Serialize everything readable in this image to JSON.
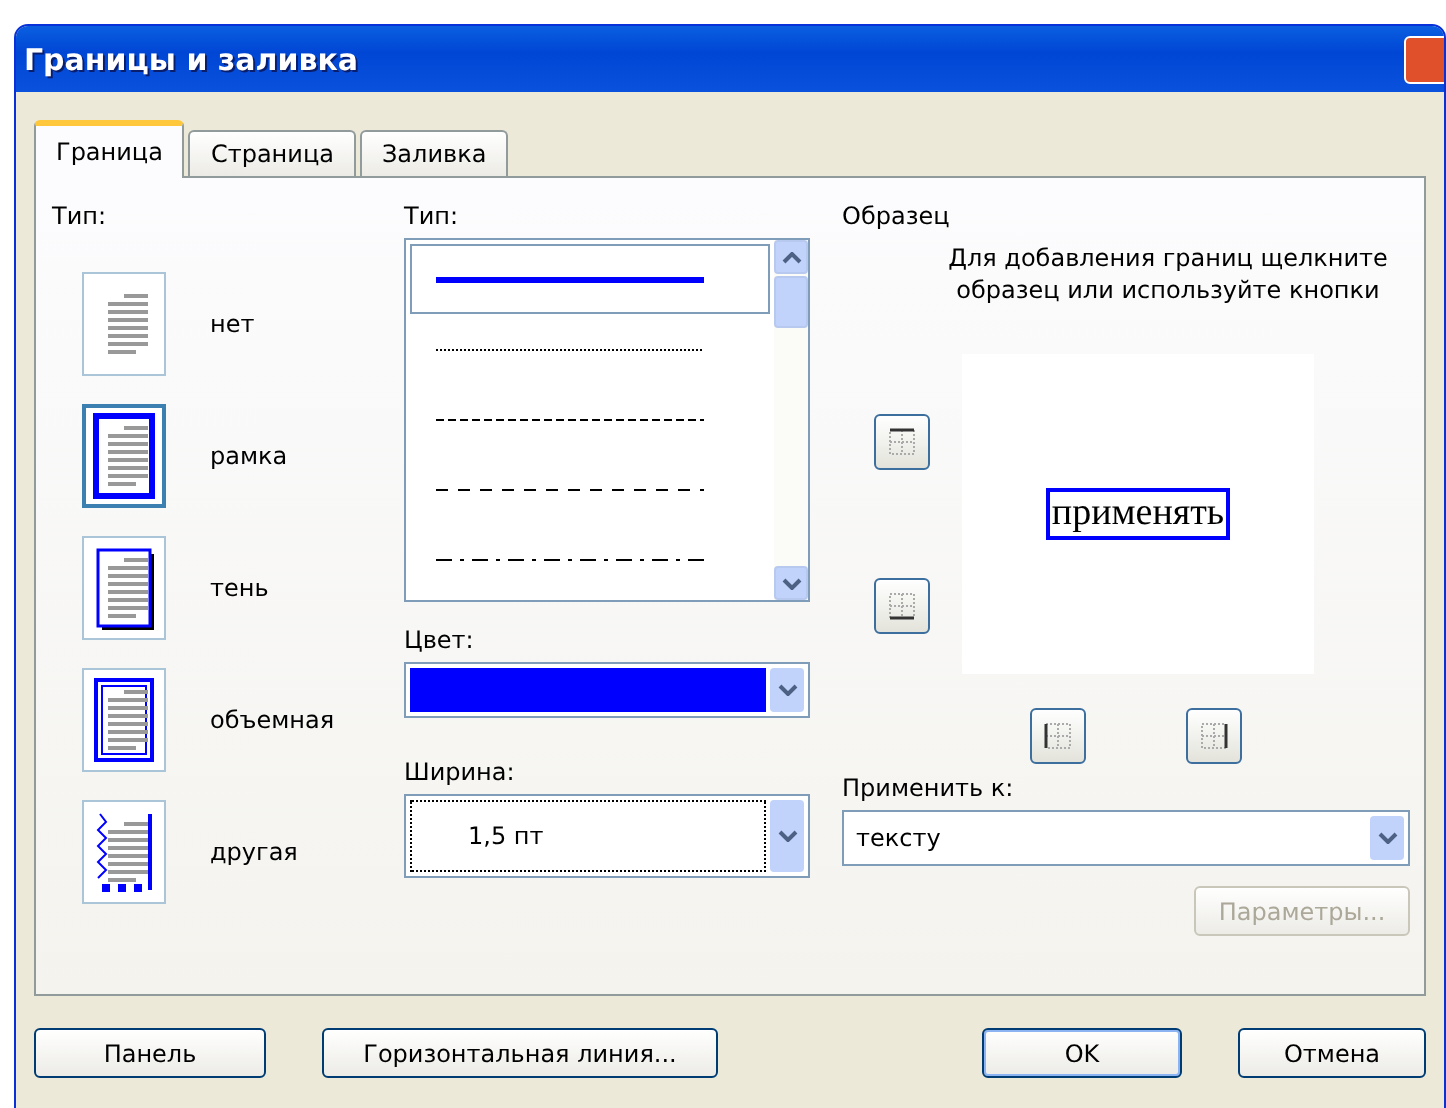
{
  "window": {
    "title": "Границы и заливка"
  },
  "tabs": [
    {
      "label": "Граница",
      "selected": true
    },
    {
      "label": "Страница",
      "selected": false
    },
    {
      "label": "Заливка",
      "selected": false
    }
  ],
  "setting": {
    "label": "Тип:",
    "presets": [
      {
        "kind": "none",
        "label": "нет",
        "selected": false
      },
      {
        "kind": "box",
        "label": "рамка",
        "selected": true
      },
      {
        "kind": "shadow",
        "label": "тень",
        "selected": false
      },
      {
        "kind": "raised",
        "label": "объемная",
        "selected": false
      },
      {
        "kind": "custom",
        "label": "другая",
        "selected": false
      }
    ]
  },
  "style": {
    "label": "Тип:",
    "lines": [
      {
        "kind": "solid",
        "selected": true
      },
      {
        "kind": "dotted",
        "selected": false
      },
      {
        "kind": "dashed",
        "selected": false
      },
      {
        "kind": "dashed-wide",
        "selected": false
      },
      {
        "kind": "dash-dot",
        "selected": false
      }
    ],
    "color_label": "Цвет:",
    "color": "#0000ff",
    "width_label": "Ширина:",
    "width_value": "1,5 пт"
  },
  "preview": {
    "label": "Образец",
    "hint": "Для добавления границ щелкните образец или используйте кнопки",
    "sample": "применять",
    "apply_label": "Применить к:",
    "apply_value": "тексту",
    "options_button": "Параметры...",
    "options_disabled": true
  },
  "buttons": [
    {
      "label": "Панель",
      "kind": "left"
    },
    {
      "label": "Горизонтальная линия...",
      "kind": "left"
    },
    {
      "label": "OK",
      "kind": "default"
    },
    {
      "label": "Отмена",
      "kind": "right"
    }
  ]
}
